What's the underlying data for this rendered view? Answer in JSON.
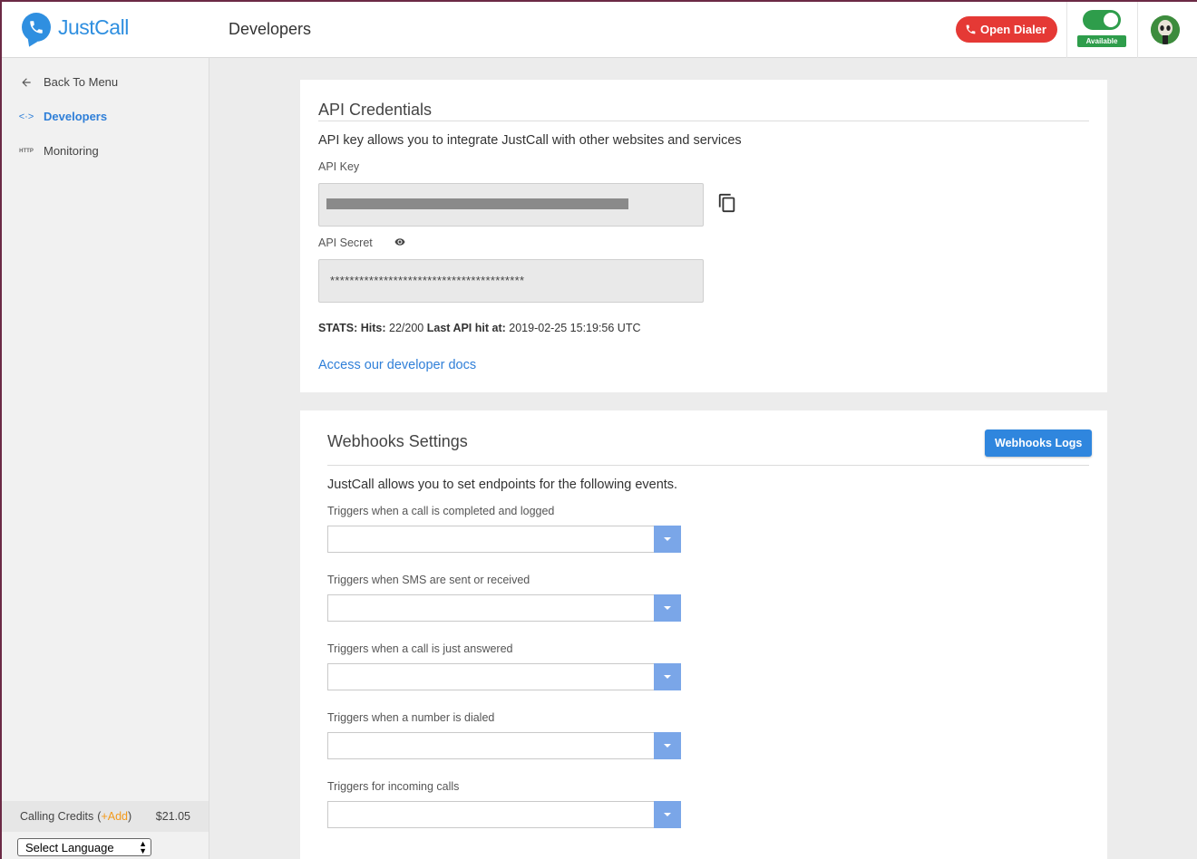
{
  "app": {
    "logo_text": "JustCall",
    "page_title": "Developers",
    "open_dialer_label": "Open Dialer",
    "availability_label": "Available"
  },
  "colors": {
    "brand": "#2f8fe0",
    "dialer": "#e53935",
    "available": "#2e9d4b",
    "link": "#2f7fd8",
    "credits_add": "#f39a1c"
  },
  "sidebar": {
    "items": [
      {
        "label": "Back To Menu",
        "icon": "arrow-left-icon"
      },
      {
        "label": "Developers",
        "icon": "code-icon"
      },
      {
        "label": "Monitoring",
        "icon": "http-icon"
      }
    ],
    "credits_label": "Calling Credits",
    "credits_add": "+Add",
    "credits_amount": "$21.05",
    "language_select": "Select Language"
  },
  "api": {
    "title": "API Credentials",
    "description": "API key allows you to integrate JustCall with other websites and services",
    "key_label": "API Key",
    "secret_label": "API Secret",
    "secret_value": "****************************************",
    "stats_prefix": "STATS: Hits:",
    "stats_hits": "22/200",
    "stats_last_label": "Last API hit at:",
    "stats_last_value": "2019-02-25 15:19:56 UTC",
    "docs_link": "Access our developer docs"
  },
  "webhooks": {
    "title": "Webhooks Settings",
    "logs_button": "Webhooks Logs",
    "description": "JustCall allows you to set endpoints for the following events.",
    "triggers": [
      {
        "label": "Triggers when a call is completed and logged",
        "value": ""
      },
      {
        "label": "Triggers when SMS are sent or received",
        "value": ""
      },
      {
        "label": "Triggers when a call is just answered",
        "value": ""
      },
      {
        "label": "Triggers when a number is dialed",
        "value": ""
      },
      {
        "label": "Triggers for incoming calls",
        "value": ""
      }
    ]
  }
}
